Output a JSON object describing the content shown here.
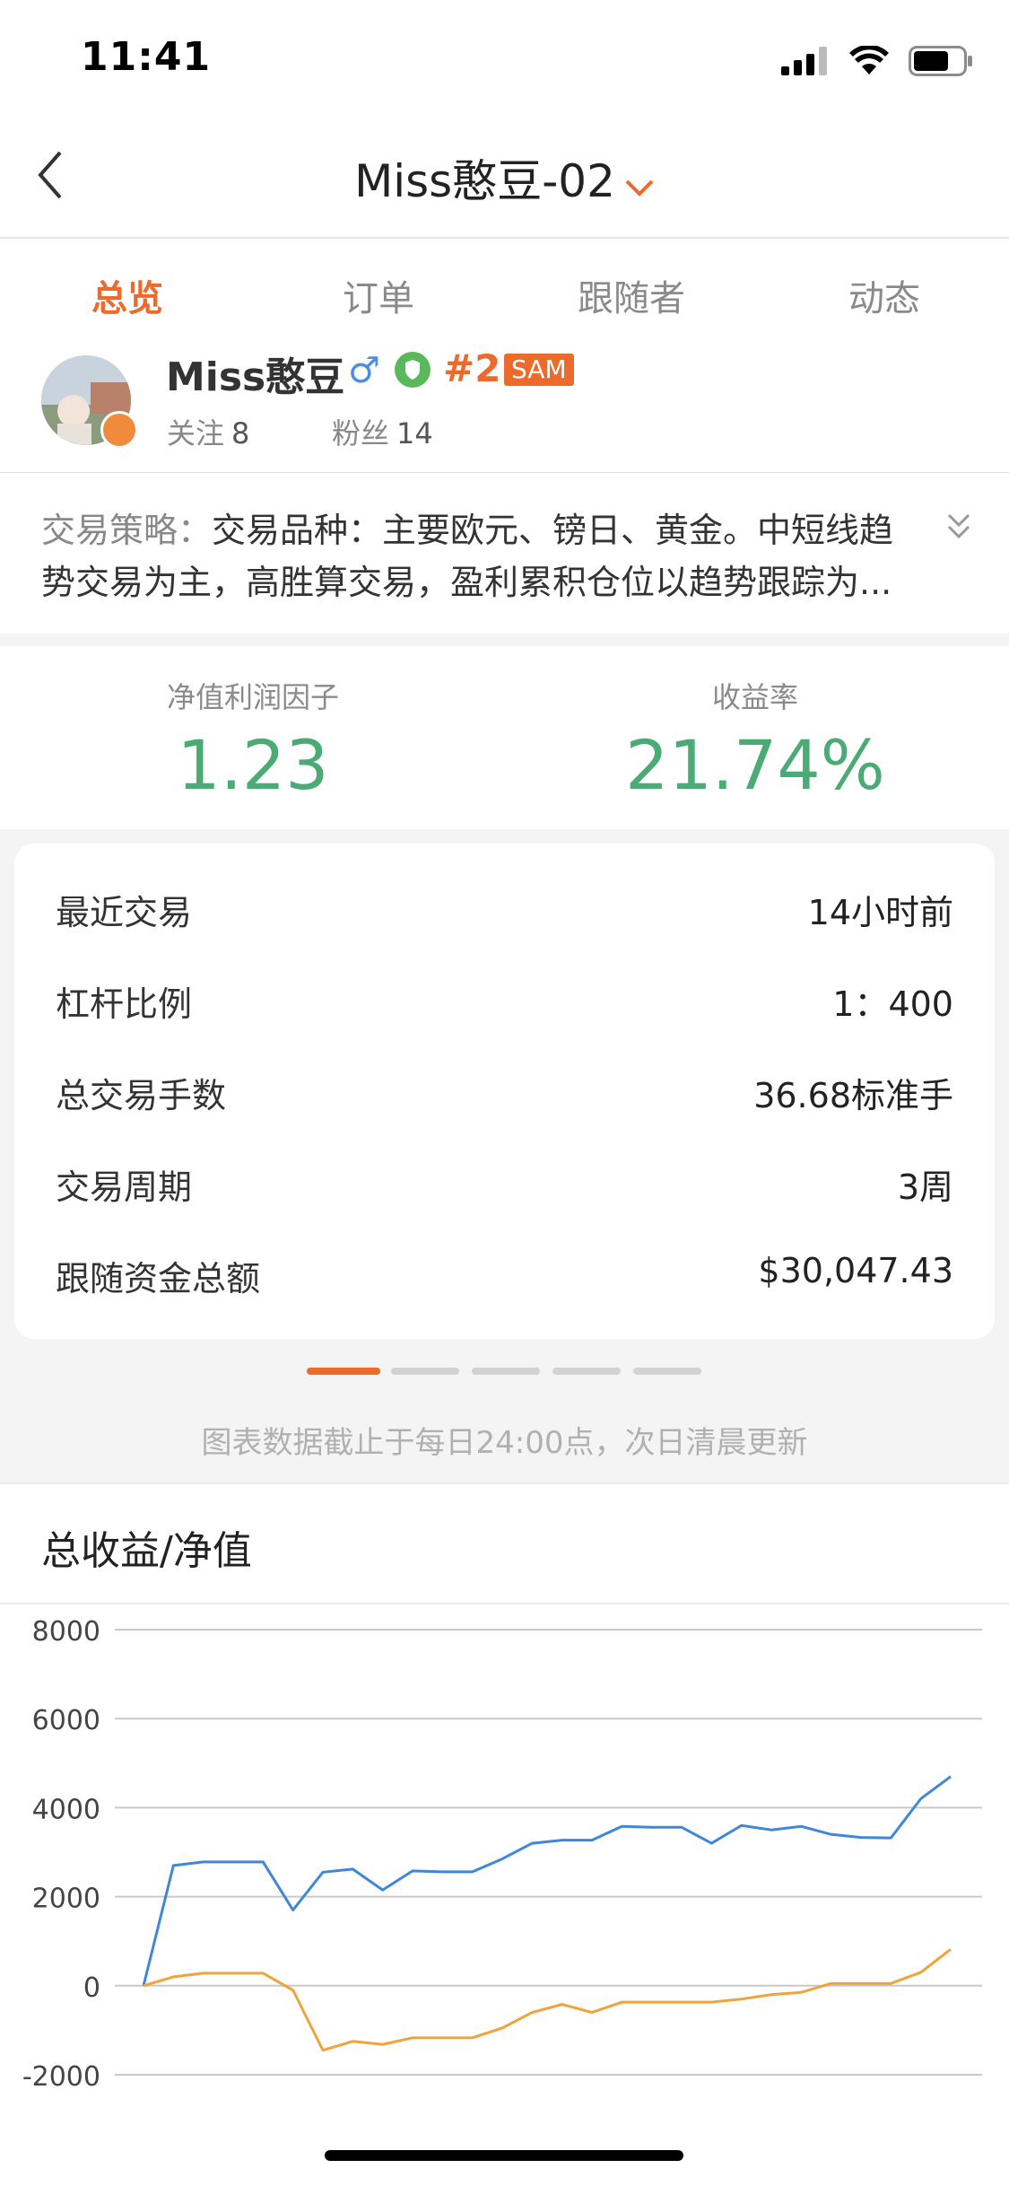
{
  "status_bar": {
    "time": "11:41"
  },
  "nav": {
    "title": "Miss憨豆-02"
  },
  "tabs": [
    {
      "label": "总览",
      "active": true
    },
    {
      "label": "订单",
      "active": false
    },
    {
      "label": "跟随者",
      "active": false
    },
    {
      "label": "动态",
      "active": false
    }
  ],
  "profile": {
    "name": "Miss憨豆",
    "gender_symbol": "♂",
    "rank": "#2",
    "tag": "SAM",
    "follow_label": "关注",
    "follow_count": "8",
    "fans_label": "粉丝",
    "fans_count": "14"
  },
  "strategy": {
    "label": "交易策略：",
    "text": "交易品种：主要欧元、镑日、黄金。中短线趋势交易为主，高胜算交易，盈利累积仓位以趋势跟踪为..."
  },
  "stats": [
    {
      "label": "净值利润因子",
      "value": "1.23"
    },
    {
      "label": "收益率",
      "value": "21.74%"
    }
  ],
  "details": [
    {
      "label": "最近交易",
      "value": "14小时前"
    },
    {
      "label": "杠杆比例",
      "value": "1：400"
    },
    {
      "label": "总交易手数",
      "value": "36.68标准手"
    },
    {
      "label": "交易周期",
      "value": "3周"
    },
    {
      "label": "跟随资金总额",
      "value": "$30,047.43"
    }
  ],
  "pager": {
    "count": 5,
    "active_index": 0
  },
  "note": "图表数据截止于每日24:00点，次日清晨更新",
  "chart_section_title": "总收益/净值",
  "colors": {
    "accent": "#ec6a2b",
    "green": "#4bab74",
    "blue_series": "#3f87d8",
    "orange_series": "#efa33b"
  },
  "chart_data": {
    "type": "line",
    "title": "",
    "ylim": [
      -2000,
      8000
    ],
    "yticks": [
      8000,
      6000,
      4000,
      2000,
      0,
      -2000
    ],
    "x": [
      0,
      1,
      2,
      3,
      4,
      5,
      6,
      7,
      8,
      9,
      10,
      11,
      12,
      13,
      14,
      15,
      16,
      17,
      18,
      19,
      20,
      21,
      22,
      23,
      24,
      25,
      26,
      27
    ],
    "series": [
      {
        "color": "#3f87d8",
        "values": [
          0,
          2700,
          2780,
          2780,
          2780,
          1700,
          2550,
          2620,
          2150,
          2580,
          2560,
          2560,
          2850,
          3200,
          3270,
          3270,
          3580,
          3560,
          3560,
          3200,
          3600,
          3500,
          3580,
          3400,
          3330,
          3320,
          4200,
          4700
        ]
      },
      {
        "color": "#efa33b",
        "values": [
          0,
          200,
          280,
          280,
          280,
          -100,
          -1450,
          -1250,
          -1320,
          -1170,
          -1170,
          -1170,
          -950,
          -600,
          -420,
          -600,
          -370,
          -370,
          -370,
          -370,
          -300,
          -200,
          -150,
          50,
          50,
          50,
          300,
          820
        ]
      }
    ]
  }
}
